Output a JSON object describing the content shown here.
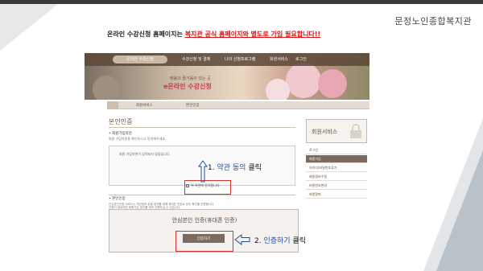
{
  "org_name": "문정노인종합복지관",
  "notice": {
    "prefix": "온라인 수강신청 홈페이지는",
    "highlight": "복지관 공식 홈페이지와 별도로 가입 필요합니다!!"
  },
  "site": {
    "nav": {
      "logo": "온라인 수강신청",
      "items": [
        "수강신청 및 결제",
        "나의 신청프로그램",
        "회원서비스",
        "로그인"
      ]
    },
    "banner": {
      "tagline": "배움의 즐거움이 있는 곳",
      "title": "e온라인 수강신청"
    },
    "subnav": {
      "tab_a": "회원서비스",
      "tab_b": "본인인증"
    },
    "page_title": "본인인증",
    "section1": {
      "title": "• 회원가입약관",
      "subtitle": "회원 가입약관을 확인하시고 동의해주세요.",
      "terms_text": "회원 가입약관이 입력되지 않았습니다.",
      "agree_label": "위 약관에 동의합니다."
    },
    "section2": {
      "title": "• 본인인증",
      "desc1": "안심본인인증 서비스는 개인정보 유출 방지를 위해 휴대폰 번호로 본인 확인을 진행합니다.",
      "desc2": "인증이 완료되면 회원가입 절차를 계속 진행하실 수 있습니다."
    },
    "cert": {
      "title": "안심본인 인증(휴대폰 인증)",
      "button": "인증하기"
    },
    "sidebar": {
      "heading": "회원서비스",
      "items": [
        "로그인",
        "회원가입",
        "아이디/비밀번호찾기",
        "회원정보수정",
        "비밀번호변경",
        "회원탈퇴"
      ],
      "active_index": 1
    }
  },
  "annotations": {
    "step1_number": "1.",
    "step1_text": "약관 동의",
    "step1_suffix": "클릭",
    "step2_number": "2.",
    "step2_text": "인증하기",
    "step2_suffix": "클릭",
    "highlight_color": "#d9342b",
    "text_blue": "#1f4e9e"
  }
}
